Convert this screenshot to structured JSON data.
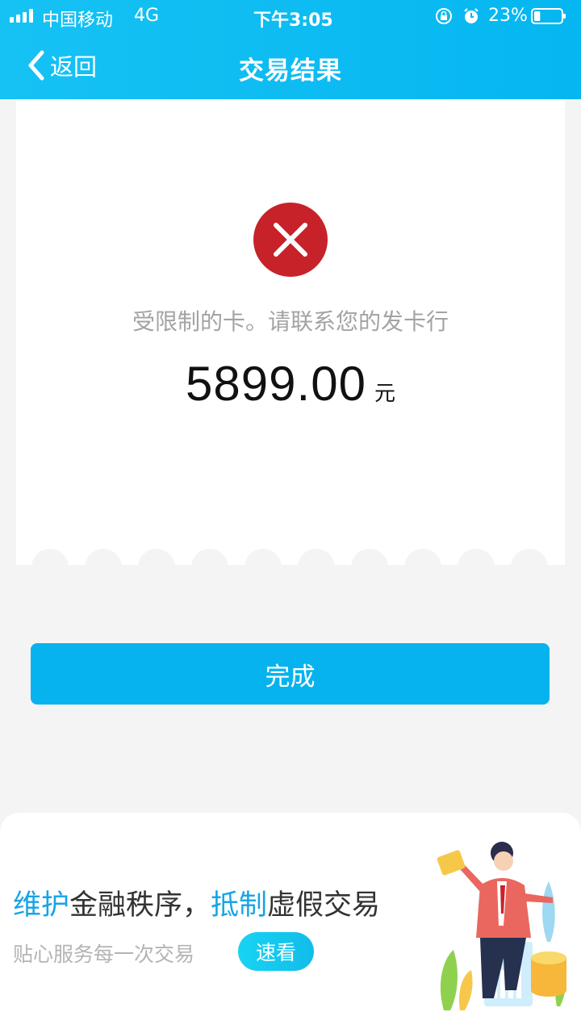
{
  "status_bar": {
    "carrier": "中国移动",
    "network": "4G",
    "time": "下午3:05",
    "battery_percent": "23%",
    "battery_level": 0.23
  },
  "nav": {
    "back_label": "返回",
    "title": "交易结果"
  },
  "result": {
    "message": "受限制的卡。请联系您的发卡行",
    "amount": "5899.00",
    "currency": "元",
    "status_color": "#c7222a"
  },
  "actions": {
    "done_label": "完成"
  },
  "promo": {
    "headline_parts": [
      {
        "text": "维护",
        "highlight": true
      },
      {
        "text": "金融秩序，",
        "highlight": false
      },
      {
        "text": "抵制",
        "highlight": true
      },
      {
        "text": "虚假交易",
        "highlight": false
      }
    ],
    "subtitle": "贴心服务每一次交易",
    "button_label": "速看"
  },
  "colors": {
    "header": "#05b6f0",
    "primary_button": "#06b3ee",
    "highlight": "#16a4e6"
  }
}
